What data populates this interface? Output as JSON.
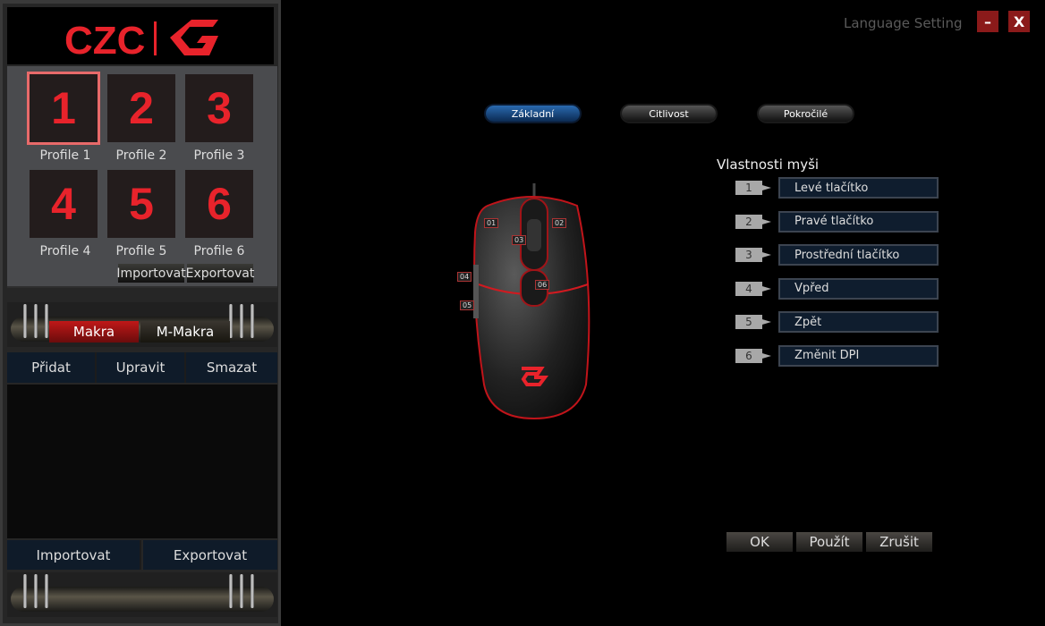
{
  "brand": {
    "logo_text": "CZC",
    "accent": "#e8232b"
  },
  "window": {
    "language_setting": "Language Setting",
    "minimize": "–",
    "close": "X"
  },
  "profiles": {
    "items": [
      {
        "number": "1",
        "label": "Profile 1",
        "selected": true
      },
      {
        "number": "2",
        "label": "Profile 2"
      },
      {
        "number": "3",
        "label": "Profile 3"
      },
      {
        "number": "4",
        "label": "Profile 4"
      },
      {
        "number": "5",
        "label": "Profile 5"
      },
      {
        "number": "6",
        "label": "Profile 6"
      }
    ],
    "import": "Importovat",
    "export": "Exportovat"
  },
  "macro": {
    "tabs": [
      "Makra",
      "M-Makra"
    ],
    "actions": [
      "Přidat",
      "Upravit",
      "Smazat"
    ],
    "import": "Importovat",
    "export": "Exportovat"
  },
  "tabs": [
    "Základní",
    "Citlivost",
    "Pokročilé"
  ],
  "mouse_properties": {
    "title": "Vlastnosti myši",
    "buttons": [
      {
        "num": "1",
        "label": "Levé tlačítko"
      },
      {
        "num": "2",
        "label": "Pravé tlačítko"
      },
      {
        "num": "3",
        "label": "Prostřední tlačítko"
      },
      {
        "num": "4",
        "label": "Vpřed"
      },
      {
        "num": "5",
        "label": "Zpět"
      },
      {
        "num": "6",
        "label": "Změnit DPI"
      }
    ]
  },
  "mouse_markers": [
    "01",
    "02",
    "03",
    "04",
    "05",
    "06"
  ],
  "footer": {
    "ok": "OK",
    "apply": "Použít",
    "cancel": "Zrušit"
  }
}
